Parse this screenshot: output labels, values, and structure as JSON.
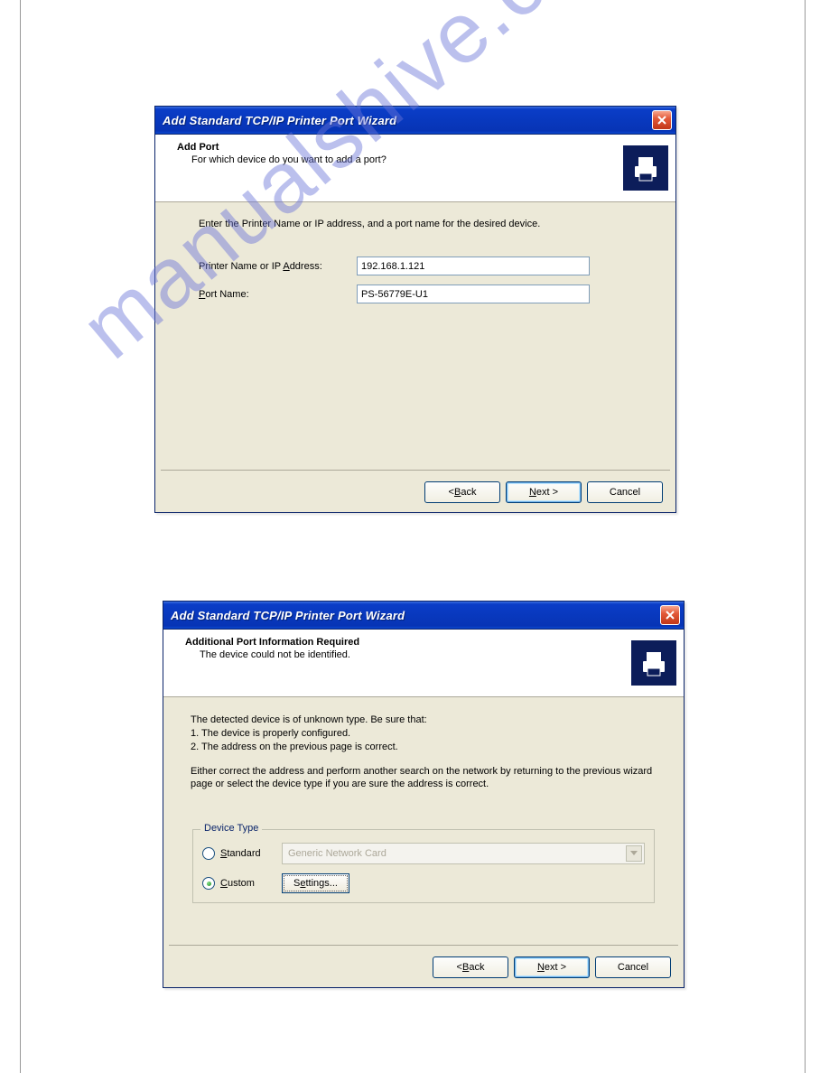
{
  "watermark": "manualshive.com",
  "dialog1": {
    "title": "Add Standard TCP/IP Printer Port Wizard",
    "header_title": "Add Port",
    "header_subtitle": "For which device do you want to add a port?",
    "instruction": "Enter the Printer Name or IP address, and a port name for the desired device.",
    "label_printer": "Printer Name or IP ",
    "label_printer_ul": "A",
    "label_printer_after": "ddress:",
    "value_printer": "192.168.1.121",
    "label_port_ul": "P",
    "label_port_after": "ort Name:",
    "value_port": "PS-56779E-U1",
    "btn_back": "< Back",
    "btn_next": "Next >",
    "btn_cancel": "Cancel"
  },
  "dialog2": {
    "title": "Add Standard TCP/IP Printer Port Wizard",
    "header_title": "Additional Port Information Required",
    "header_subtitle": "The device could not be identified.",
    "para1_a": "The detected device is of unknown type.  Be sure that:",
    "para1_b": "1.  The device is properly configured.",
    "para1_c": "2.  The address on the previous page is correct.",
    "para2": "Either correct the address and perform another search on the network by returning to the previous wizard page or select the device type if you are sure the address is correct.",
    "groupbox_title": "Device Type",
    "radio_standard_ul": "S",
    "radio_standard_after": "tandard",
    "dropdown_value": "Generic Network Card",
    "radio_custom_ul": "C",
    "radio_custom_after": "ustom",
    "btn_settings": "Settings...",
    "btn_back": "< Back",
    "btn_next": "Next >",
    "btn_cancel": "Cancel"
  }
}
